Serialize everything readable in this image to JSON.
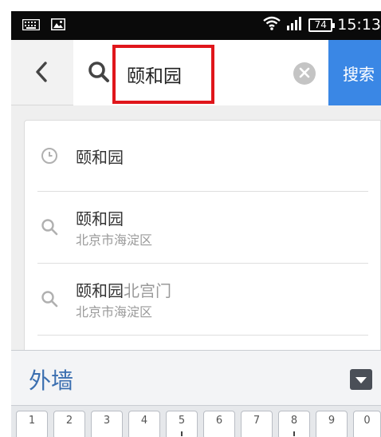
{
  "status_bar": {
    "time": "15:13",
    "battery": "74",
    "left_icons": [
      "keyboard-icon",
      "image-icon"
    ],
    "right_icons": [
      "wifi-icon",
      "signal-icon",
      "battery-icon"
    ]
  },
  "search": {
    "query": "颐和园",
    "button_label": "搜索",
    "back_icon": "back-arrow-icon",
    "clear_icon": "clear-icon"
  },
  "suggestions": [
    {
      "type": "history",
      "icon": "clock-icon",
      "title": "颐和园",
      "subtitle": ""
    },
    {
      "type": "place",
      "icon": "search-icon",
      "title": "颐和园",
      "subtitle": "北京市海淀区"
    },
    {
      "type": "place",
      "icon": "search-icon",
      "title": "颐和园",
      "title_suffix": "北宫门",
      "subtitle": "北京市海淀区"
    }
  ],
  "keyboard": {
    "candidate": "外墙",
    "collapse_icon": "collapse-triangle-icon",
    "number_keys": [
      "1",
      "2",
      "3",
      "4",
      "5",
      "6",
      "7",
      "8",
      "9",
      "0"
    ]
  },
  "colors": {
    "accent_blue": "#3a87e5",
    "highlight_red": "#e0161b",
    "candidate_blue": "#3b6fb0",
    "status_bar": "#0a0a0a"
  }
}
